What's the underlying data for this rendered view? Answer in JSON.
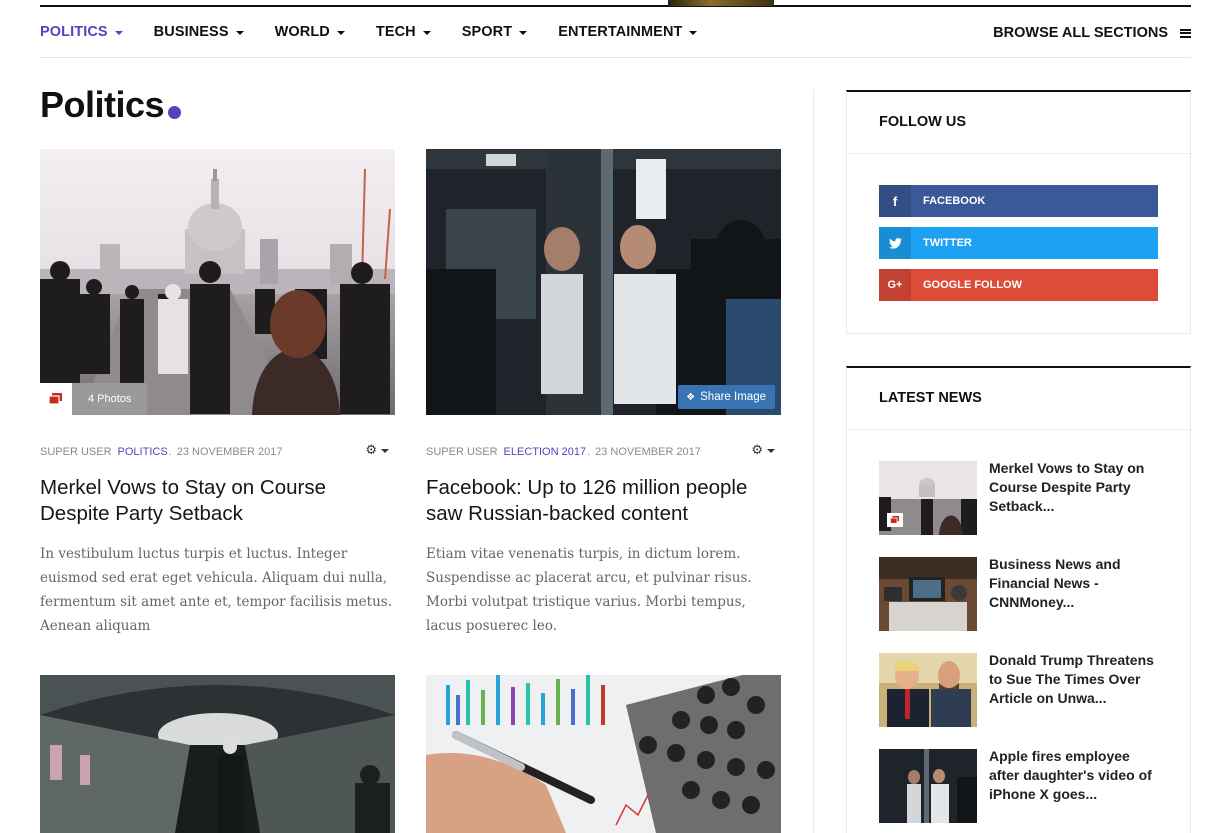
{
  "nav": {
    "items": [
      {
        "label": "POLITICS",
        "active": true
      },
      {
        "label": "BUSINESS",
        "active": false
      },
      {
        "label": "WORLD",
        "active": false
      },
      {
        "label": "TECH",
        "active": false
      },
      {
        "label": "SPORT",
        "active": false
      },
      {
        "label": "ENTERTAINMENT",
        "active": false
      }
    ],
    "browse_label": "BROWSE ALL SECTIONS",
    "accent_color": "#5a3fbf"
  },
  "page": {
    "title": "Politics"
  },
  "articles": [
    {
      "author": "SUPER USER",
      "category": "POLITICS",
      "date": "23 NOVEMBER 2017",
      "title": "Merkel Vows to Stay on Course Despite Party Setback",
      "excerpt": "In vestibulum luctus turpis et luctus. Integer euismod sed erat eget vehicula. Aliquam dui nulla, fermentum sit amet ante et, tempor facilisis metus. Aenean aliquam",
      "badge_label": "4 Photos"
    },
    {
      "author": "SUPER USER",
      "category": "ELECTION 2017",
      "date": "23 NOVEMBER 2017",
      "title": "Facebook: Up to 126 million people saw Russian-backed content",
      "excerpt": "Etiam vitae venenatis turpis, in dictum lorem. Suspendisse ac placerat arcu, et pulvinar risus. Morbi volutpat tristique varius. Morbi tempus, lacus posuerec leo.",
      "share_label": "Share Image"
    }
  ],
  "sidebar": {
    "follow": {
      "title": "FOLLOW US",
      "buttons": [
        {
          "label": "FACEBOOK",
          "icon": "facebook-icon",
          "color": "#3b5998"
        },
        {
          "label": "TWITTER",
          "icon": "twitter-icon",
          "color": "#1da1f2"
        },
        {
          "label": "GOOGLE FOLLOW",
          "icon": "google-plus-icon",
          "color": "#dd4b39"
        }
      ]
    },
    "latest": {
      "title": "LATEST NEWS",
      "items": [
        {
          "title": "Merkel Vows to Stay on Course Despite Party Setback..."
        },
        {
          "title": "Business News and Financial News - CNNMoney..."
        },
        {
          "title": "Donald Trump Threatens to Sue The Times Over Article on Unwa..."
        },
        {
          "title": "Apple fires employee after daughter's video of iPhone X goes..."
        }
      ]
    }
  }
}
